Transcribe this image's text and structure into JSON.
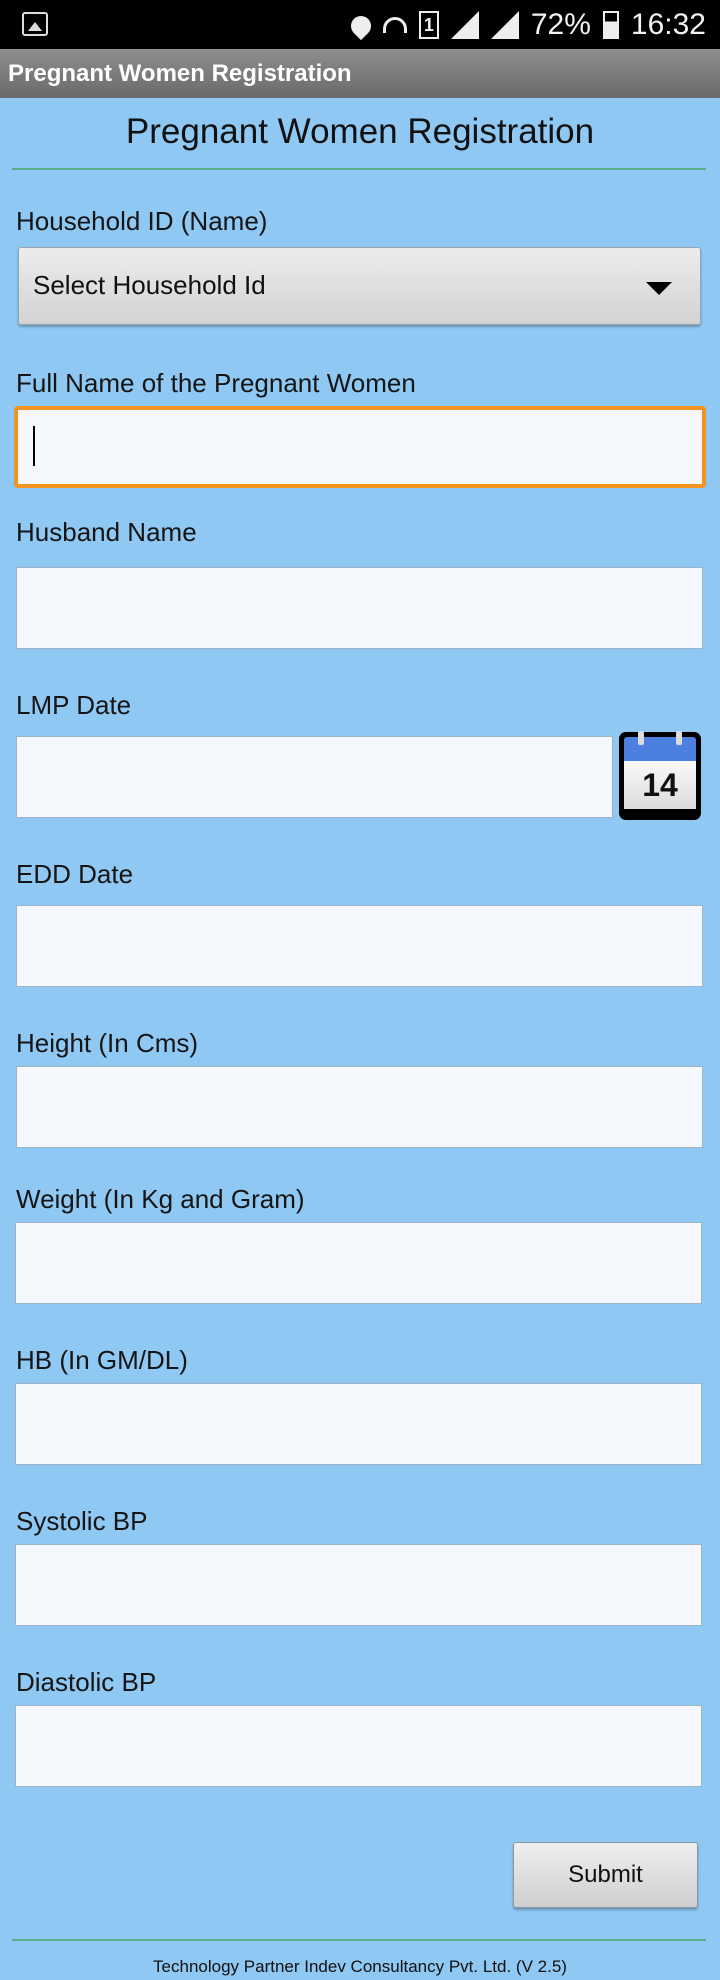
{
  "status_bar": {
    "battery": "72%",
    "time": "16:32",
    "sim_slot": "1",
    "icons": [
      "gallery-icon",
      "location-icon",
      "wifi-icon",
      "sim-icon",
      "signal-icon",
      "signal-icon",
      "battery-icon"
    ]
  },
  "app_bar": {
    "title": "Pregnant Women Registration"
  },
  "form": {
    "heading": "Pregnant Women Registration",
    "household": {
      "label": "Household ID (Name)",
      "selected": "Select Household Id"
    },
    "full_name": {
      "label": "Full Name of the  Pregnant Women",
      "value": ""
    },
    "husband_name": {
      "label": "Husband Name",
      "value": ""
    },
    "lmp_date": {
      "label": "LMP Date",
      "value": "",
      "calendar_day": "14"
    },
    "edd_date": {
      "label": "EDD Date",
      "value": ""
    },
    "height": {
      "label": "Height (In Cms)",
      "value": ""
    },
    "weight": {
      "label": "Weight (In Kg and Gram)",
      "value": ""
    },
    "hb": {
      "label": "HB (In GM/DL)",
      "value": ""
    },
    "systolic_bp": {
      "label": "Systolic BP",
      "value": ""
    },
    "diastolic_bp": {
      "label": "Diastolic BP",
      "value": ""
    },
    "submit_label": "Submit"
  },
  "footer": {
    "text": "Technology Partner Indev Consultancy Pvt. Ltd. (V 2.5)"
  },
  "colors": {
    "background": "#8ec8f3",
    "input_background": "#f5f9fd",
    "focus_border": "#f2941f",
    "rule": "#57b08c",
    "calendar_header": "#4d7fe0"
  }
}
